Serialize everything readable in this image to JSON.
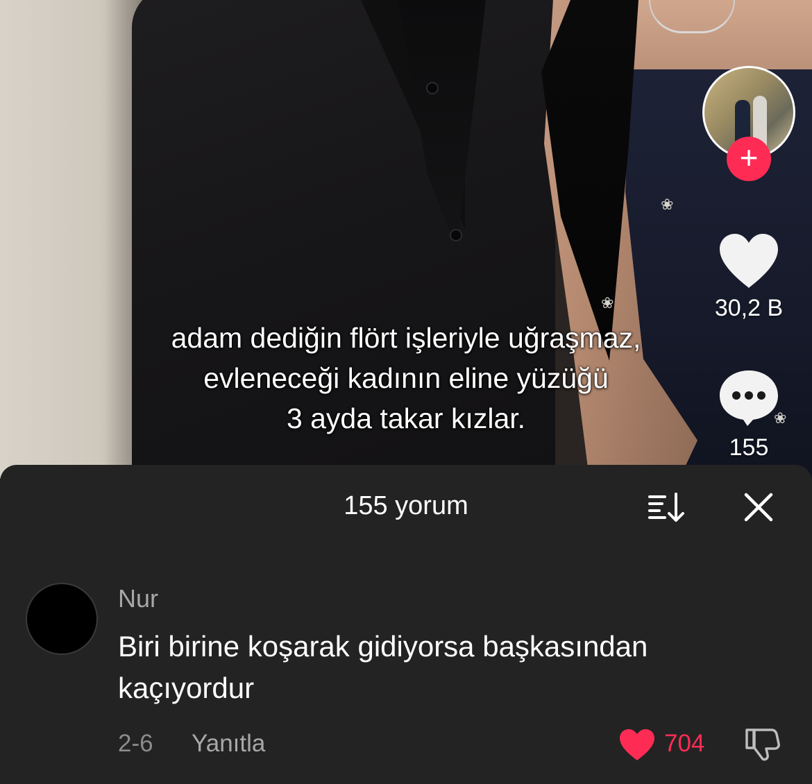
{
  "video": {
    "caption_lines": [
      "adam dediğin flört işleriyle uğraşmaz,",
      "evleneceği kadının eline yüzüğü",
      "3 ayda takar kızlar."
    ]
  },
  "action_rail": {
    "follow_symbol": "+",
    "like_count": "30,2 B",
    "comment_count": "155"
  },
  "comments_sheet": {
    "title": "155 yorum",
    "comments": [
      {
        "user": "Nur",
        "text": "Biri birine koşarak gidiyorsa başkasından kaçıyordur",
        "date": "2-6",
        "reply_label": "Yanıtla",
        "like_count": "704",
        "liked": true
      }
    ]
  },
  "colors": {
    "accent": "#fe2c55",
    "sheet_background": "#232323",
    "secondary_text": "#a8a8a8"
  },
  "icons": {
    "like": "heart-icon",
    "comment": "speech-bubble-icon",
    "sort": "sort-icon",
    "close": "close-icon",
    "dislike": "thumbs-down-icon"
  }
}
